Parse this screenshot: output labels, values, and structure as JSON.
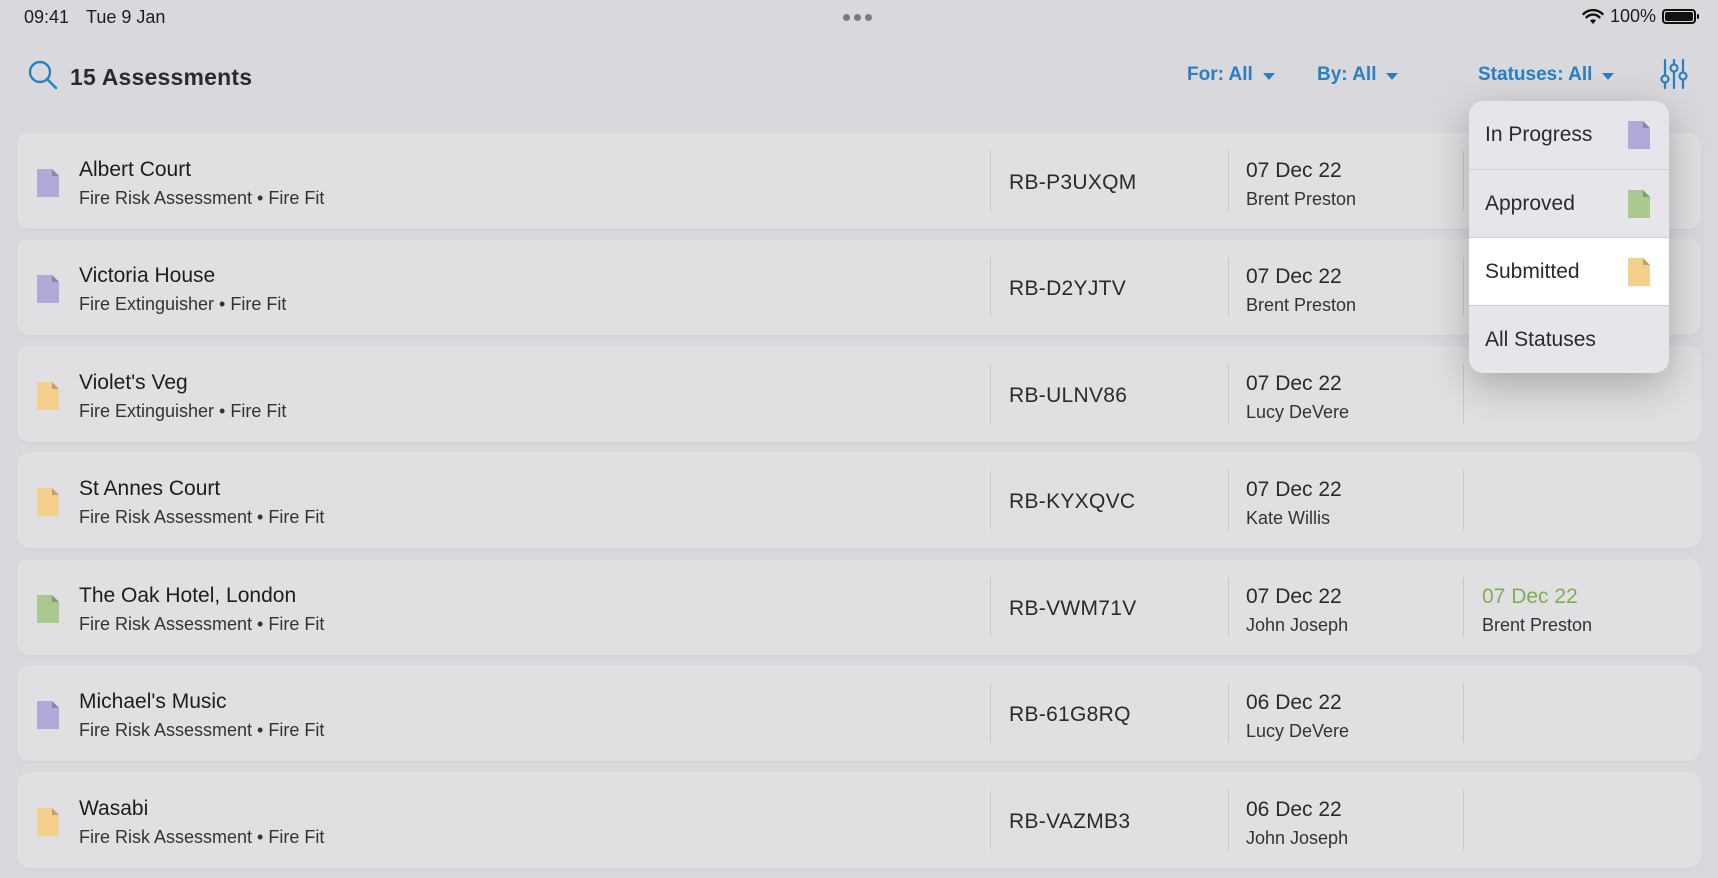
{
  "status_bar": {
    "time": "09:41",
    "date": "Tue 9 Jan",
    "battery": "100%"
  },
  "header": {
    "title": "15 Assessments",
    "filters": {
      "for": "For: All",
      "by": "By: All",
      "statuses": "Statuses: All"
    }
  },
  "colors": {
    "in_progress": "#b3a9d8",
    "approved": "#a9c98f",
    "submitted": "#f5cf8e",
    "accent": "#2a7fc1"
  },
  "rows": [
    {
      "name": "Albert Court",
      "subtitle": "Fire Risk Assessment • Fire Fit",
      "ref": "RB-P3UXQM",
      "date": "07 Dec 22",
      "by": "Brent Preston",
      "status": "in_progress",
      "approved_date": "",
      "approved_by": ""
    },
    {
      "name": "Victoria House",
      "subtitle": "Fire Extinguisher • Fire Fit",
      "ref": "RB-D2YJTV",
      "date": "07 Dec 22",
      "by": "Brent Preston",
      "status": "in_progress",
      "approved_date": "",
      "approved_by": ""
    },
    {
      "name": "Violet's Veg",
      "subtitle": "Fire Extinguisher • Fire Fit",
      "ref": "RB-ULNV86",
      "date": "07 Dec 22",
      "by": "Lucy DeVere",
      "status": "submitted",
      "approved_date": "",
      "approved_by": ""
    },
    {
      "name": "St Annes Court",
      "subtitle": "Fire Risk Assessment • Fire Fit",
      "ref": "RB-KYXQVC",
      "date": "07 Dec 22",
      "by": "Kate Willis",
      "status": "submitted",
      "approved_date": "",
      "approved_by": ""
    },
    {
      "name": "The Oak Hotel, London",
      "subtitle": "Fire Risk Assessment • Fire Fit",
      "ref": "RB-VWM71V",
      "date": "07 Dec 22",
      "by": "John Joseph",
      "status": "approved",
      "approved_date": "07 Dec 22",
      "approved_by": "Brent Preston"
    },
    {
      "name": "Michael's Music",
      "subtitle": "Fire Risk Assessment • Fire Fit",
      "ref": "RB-61G8RQ",
      "date": "06 Dec 22",
      "by": "Lucy DeVere",
      "status": "in_progress",
      "approved_date": "",
      "approved_by": ""
    },
    {
      "name": "Wasabi",
      "subtitle": "Fire Risk Assessment • Fire Fit",
      "ref": "RB-VAZMB3",
      "date": "06 Dec 22",
      "by": "John Joseph",
      "status": "submitted",
      "approved_date": "",
      "approved_by": ""
    }
  ],
  "status_menu": [
    {
      "label": "In Progress",
      "status": "in_progress",
      "selected": false
    },
    {
      "label": "Approved",
      "status": "approved",
      "selected": false
    },
    {
      "label": "Submitted",
      "status": "submitted",
      "selected": true
    },
    {
      "label": "All Statuses",
      "status": "",
      "selected": false
    }
  ]
}
